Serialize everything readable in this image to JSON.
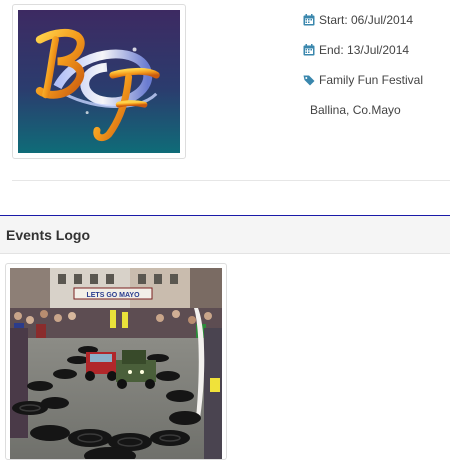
{
  "event": {
    "logo_text": "BF",
    "start": "Start: 06/Jul/2014",
    "end": "End: 13/Jul/2014",
    "category": "Family Fun Festival",
    "location": "Ballina, Co.Mayo",
    "icons": {
      "start": "calendar-icon",
      "end": "calendar-icon",
      "category": "tag-icon"
    }
  },
  "events_logo_section": {
    "title": "Events Logo",
    "photo_banner_text": "LETS GO MAYO"
  },
  "colors": {
    "accent": "#1a1aa8",
    "icon": "#3a87ad",
    "logo_bg_top": "#3d2a62",
    "logo_bg_bottom": "#0f6c78"
  }
}
